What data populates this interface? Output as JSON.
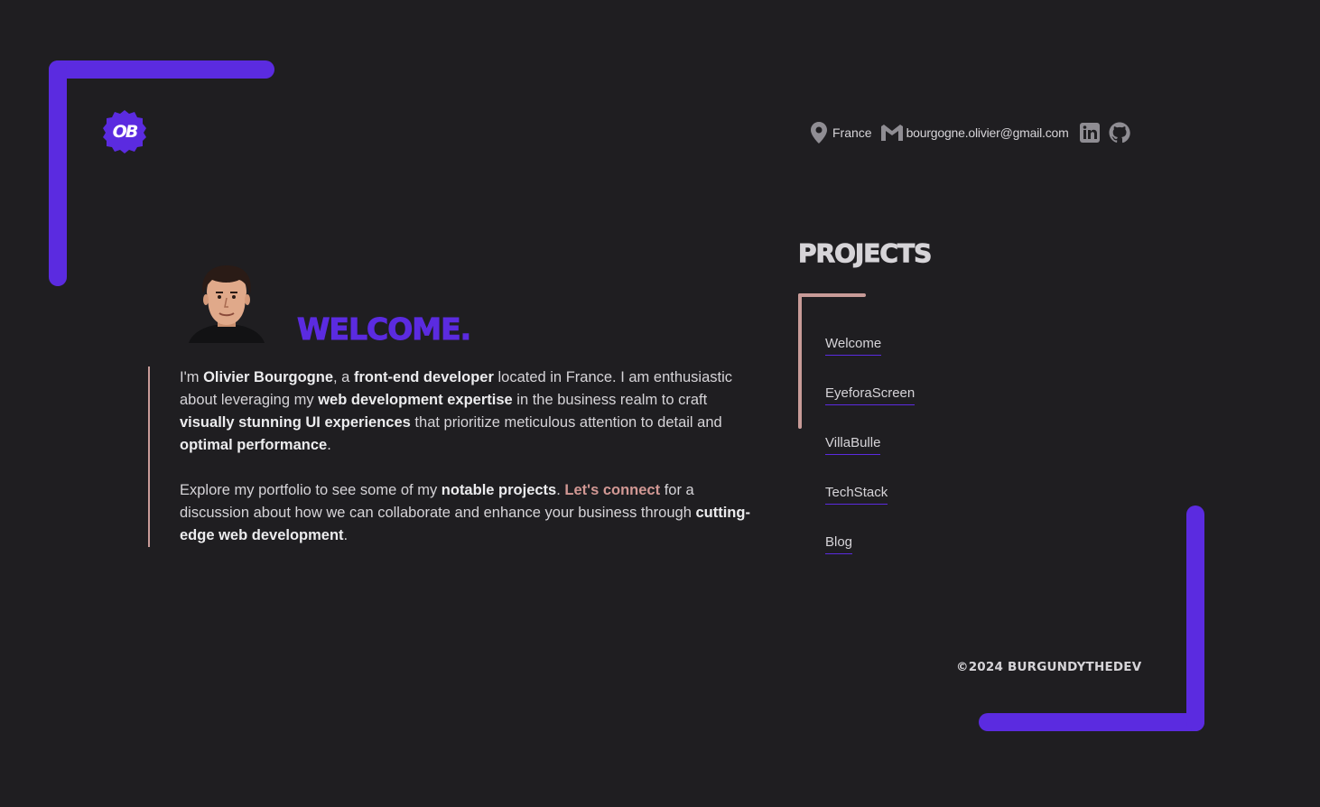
{
  "logo": {
    "text": "OB"
  },
  "contact": {
    "country": "France",
    "email": "bourgogne.olivier@gmail.com",
    "icons": [
      "location-pin-icon",
      "gmail-icon",
      "linkedin-icon",
      "github-icon"
    ]
  },
  "welcome": {
    "heading": "WELCOME.",
    "paragraph1": {
      "p1": "I'm ",
      "b1": "Olivier Bourgogne",
      "p2": ", a ",
      "b2": "front-end developer",
      "p3": " located in France. I am enthusiastic about leveraging my ",
      "b3": "web development expertise",
      "p4": " in the business realm to craft ",
      "b4": "visually stunning UI experiences",
      "p5": " that prioritize meticulous attention to detail and ",
      "b5": "optimal performance",
      "p6": "."
    },
    "paragraph2": {
      "p1": "Explore my portfolio to see some of my ",
      "b1": "notable projects",
      "p2": ". ",
      "link": "Let's connect",
      "p3": " for a discussion about how we can collaborate and enhance your business through ",
      "b2": "cutting-edge web development",
      "p4": "."
    }
  },
  "projects": {
    "title": "PROJECTS",
    "items": [
      {
        "label": "Welcome"
      },
      {
        "label": "EyeforaScreen"
      },
      {
        "label": "VillaBulle"
      },
      {
        "label": "TechStack"
      },
      {
        "label": "Blog"
      }
    ]
  },
  "footer": {
    "text": "©2024 BURGUNDYTHEDEV"
  },
  "colors": {
    "background": "#1f1e21",
    "accent": "#5b2be0",
    "highlight": "#d29894",
    "text": "#d6d4d8"
  }
}
